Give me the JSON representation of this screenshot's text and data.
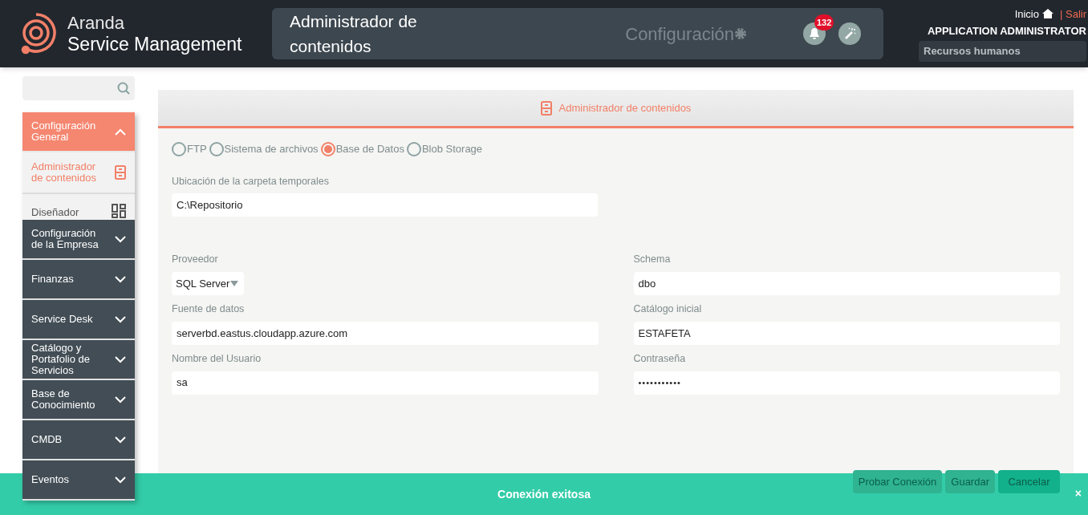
{
  "header": {
    "brand_top": "Aranda",
    "brand_bottom": "Service Management",
    "title": "Administrador de contenidos",
    "section": "Configuración",
    "notifications": "132",
    "home_link": "Inicio",
    "logout_link": "| Salir",
    "user": "APPLICATION ADMINISTRATOR",
    "project": "Recursos humanos"
  },
  "sidebar": {
    "items": [
      {
        "label": "Configuración General",
        "expanded": true,
        "children": [
          {
            "label": "Administrador de contenidos",
            "kind": "storage",
            "selected": true
          },
          {
            "label": "Diseñador",
            "kind": "grid",
            "selected": false
          }
        ]
      },
      {
        "label": "Configuración de la Empresa",
        "expanded": false
      },
      {
        "label": "Finanzas",
        "expanded": false
      },
      {
        "label": "Service Desk",
        "expanded": false
      },
      {
        "label": "Catálogo y Portafolio de Servicios",
        "expanded": false
      },
      {
        "label": "Base de Conocimiento",
        "expanded": false
      },
      {
        "label": "CMDB",
        "expanded": false
      },
      {
        "label": "Eventos",
        "expanded": false
      }
    ]
  },
  "panel": {
    "title": "Administrador de contenidos",
    "storage_options": [
      {
        "label": "FTP",
        "selected": false
      },
      {
        "label": "Sistema de archivos",
        "selected": false
      },
      {
        "label": "Base de Datos",
        "selected": true
      },
      {
        "label": "Blob Storage",
        "selected": false
      }
    ],
    "temp_folder": {
      "label": "Ubicación de la carpeta temporales",
      "value": "C:\\Repositorio"
    },
    "fields": [
      {
        "label": "Proveedor",
        "value": "SQL Server",
        "kind": "select"
      },
      {
        "label": "Schema",
        "value": "dbo",
        "kind": "text"
      },
      {
        "label": "Fuente de datos",
        "value": "serverbd.eastus.cloudapp.azure.com",
        "kind": "text"
      },
      {
        "label": "Catálogo inicial",
        "value": "ESTAFETA",
        "kind": "text"
      },
      {
        "label": "Nombre del Usuario",
        "value": "sa",
        "kind": "text"
      },
      {
        "label": "Contraseña",
        "value": "•••••••••••",
        "kind": "password"
      }
    ],
    "buttons": [
      "Probar Conexión",
      "Guardar",
      "Cancelar"
    ]
  },
  "toast": {
    "message": "Conexión exitosa",
    "close": "×"
  }
}
